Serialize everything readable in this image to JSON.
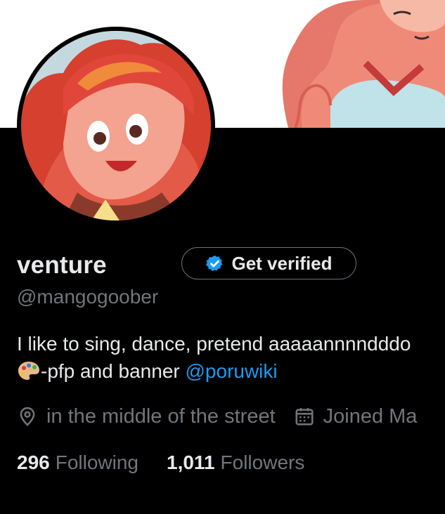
{
  "profile": {
    "display_name": "venture",
    "handle": "@mangogoober",
    "verify_button_label": "Get verified",
    "bio": {
      "line1": "I like to sing, dance, pretend aaaaannnndddo",
      "line2_text": "-pfp and banner ",
      "line2_mention": "@poruwiki"
    },
    "location": "in the middle of the street",
    "joined": "Joined Ma",
    "following_count": "296",
    "following_label": "Following",
    "followers_count": "1,011",
    "followers_label": "Followers"
  },
  "icons": {
    "verify": "verified-badge-icon",
    "palette": "artist-palette-emoji-icon",
    "location": "location-pin-icon",
    "joined": "calendar-icon"
  },
  "colors": {
    "background": "#000000",
    "primary_text": "#e7e9ea",
    "secondary_text": "#71767b",
    "link": "#1d9bf0",
    "verified_blue": "#1d9bf0"
  }
}
